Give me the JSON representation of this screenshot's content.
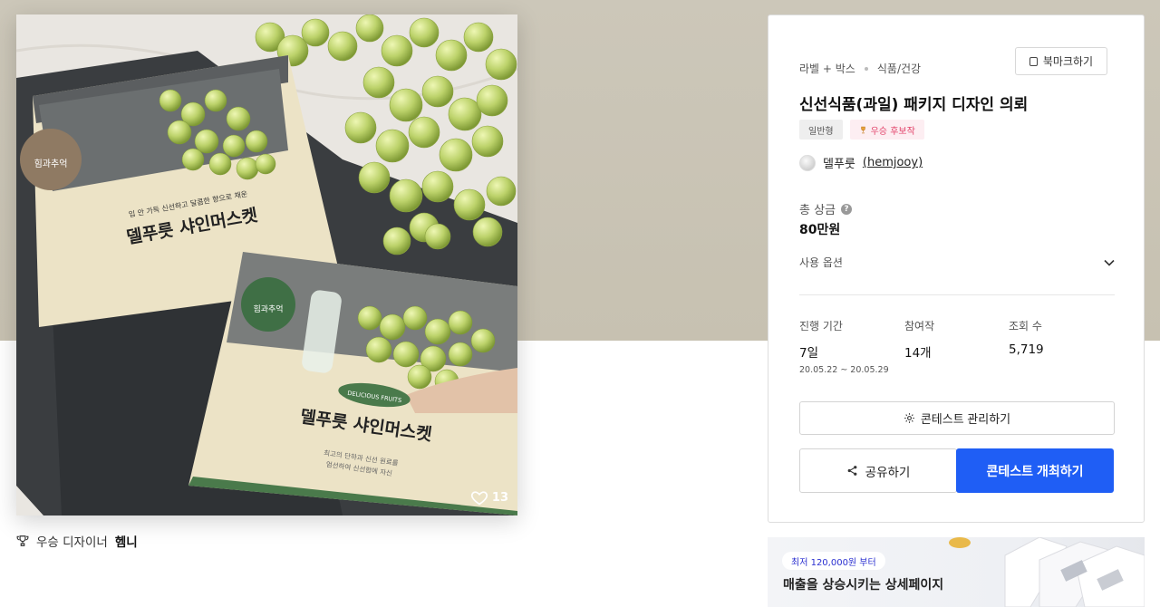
{
  "product": {
    "likes": "13",
    "image_alt": "델푸릇 샤인머스켓 packaging"
  },
  "packaging": {
    "brand_badge": "힘과추억",
    "label_brand": "DELICIOUS FRUITS",
    "tagline": "입 안 가득 신선하고 달콤한 향으로 채운",
    "product_name": "델푸릇 샤인머스켓",
    "desc_line1": "최고의 단하과 신선 원료를",
    "desc_line2": "엄선하여 신선함에 자신"
  },
  "winner": {
    "label": "우승 디자이너",
    "name": "헴니"
  },
  "contest": {
    "category": "라벨 + 박스",
    "subcategory": "식품/건강",
    "bookmark_label": "북마크하기",
    "title": "신선식품(과일) 패키지 디자인 의뢰",
    "tags": [
      "일반형",
      "우승 후보작"
    ],
    "author_name": "델푸룻",
    "author_handle": "(hemjooy)",
    "prize_label": "총 상금",
    "prize_value": "80만원",
    "usage_label": "사용 옵션",
    "stats": {
      "period_label": "진행 기간",
      "period_value": "7일",
      "period_dates": "20.05.22 ~ 20.05.29",
      "entries_label": "참여작",
      "entries_value": "14개",
      "views_label": "조회 수",
      "views_value": "5,719"
    },
    "manage_label": "콘테스트 관리하기",
    "share_label": "공유하기",
    "host_label": "콘테스트 개최하기"
  },
  "ad": {
    "badge": "최저 120,000원 부터",
    "text": "매출을 상승시키는 상세페이지"
  },
  "colors": {
    "accent_blue": "#1f5ef5",
    "hero_bg": "#c9c3b4",
    "pink_tag": "#e2436a"
  }
}
